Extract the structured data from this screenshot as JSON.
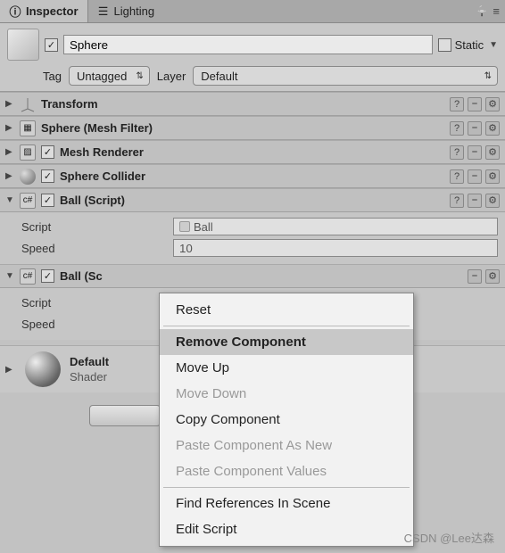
{
  "tabs": {
    "inspector": "Inspector",
    "lighting": "Lighting"
  },
  "header": {
    "enabled": true,
    "name": "Sphere",
    "static_label": "Static",
    "tag_label": "Tag",
    "tag_value": "Untagged",
    "layer_label": "Layer",
    "layer_value": "Default"
  },
  "components": [
    {
      "name": "Transform",
      "expanded": false,
      "checkbox": null
    },
    {
      "name": "Sphere (Mesh Filter)",
      "expanded": false,
      "checkbox": null
    },
    {
      "name": "Mesh Renderer",
      "expanded": false,
      "checkbox": true
    },
    {
      "name": "Sphere Collider",
      "expanded": false,
      "checkbox": true
    },
    {
      "name": "Ball (Script)",
      "expanded": true,
      "checkbox": true,
      "props": [
        {
          "label": "Script",
          "value": "Ball",
          "obj": true
        },
        {
          "label": "Speed",
          "value": "10",
          "obj": false
        }
      ]
    },
    {
      "name": "Ball (Script)",
      "expanded": true,
      "checkbox": true,
      "truncated": "Ball (Sc",
      "props": [
        {
          "label": "Script",
          "value": "",
          "obj": true
        },
        {
          "label": "Speed",
          "value": "",
          "obj": false
        }
      ]
    }
  ],
  "material": {
    "name": "Default",
    "shader_label": "Shader"
  },
  "context_menu": {
    "items": [
      {
        "label": "Reset",
        "enabled": true
      },
      {
        "sep": true
      },
      {
        "label": "Remove Component",
        "enabled": true,
        "hover": true
      },
      {
        "label": "Move Up",
        "enabled": true
      },
      {
        "label": "Move Down",
        "enabled": false
      },
      {
        "label": "Copy Component",
        "enabled": true
      },
      {
        "label": "Paste Component As New",
        "enabled": false
      },
      {
        "label": "Paste Component Values",
        "enabled": false
      },
      {
        "sep": true
      },
      {
        "label": "Find References In Scene",
        "enabled": true
      },
      {
        "label": "Edit Script",
        "enabled": true
      }
    ]
  },
  "watermark": "CSDN @Lee达森"
}
